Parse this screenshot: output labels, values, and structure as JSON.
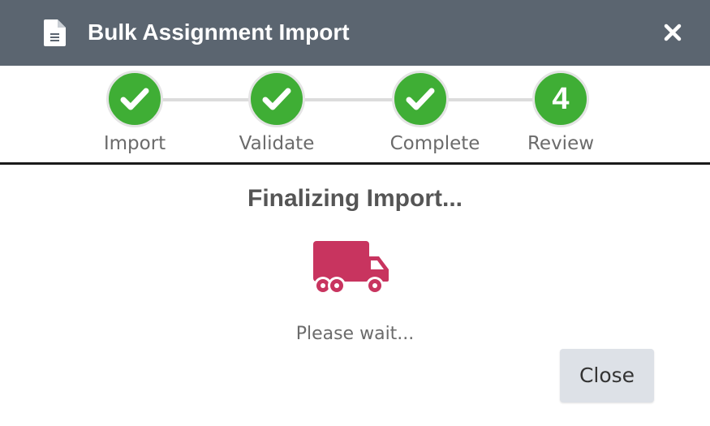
{
  "header": {
    "title": "Bulk Assignment Import",
    "icon": "document-icon",
    "close_icon": "close-icon",
    "background_color": "#5b6570"
  },
  "stepper": {
    "active_color": "#3fae35",
    "steps": [
      {
        "label": "Import",
        "state": "complete",
        "icon": "check-icon"
      },
      {
        "label": "Validate",
        "state": "complete",
        "icon": "check-icon"
      },
      {
        "label": "Complete",
        "state": "complete",
        "icon": "check-icon"
      },
      {
        "label": "Review",
        "state": "current",
        "number": "4"
      }
    ]
  },
  "main": {
    "status_title": "Finalizing Import...",
    "status_icon": "truck-icon",
    "status_icon_color": "#c8345f",
    "wait_text": "Please wait..."
  },
  "footer": {
    "close_label": "Close"
  }
}
